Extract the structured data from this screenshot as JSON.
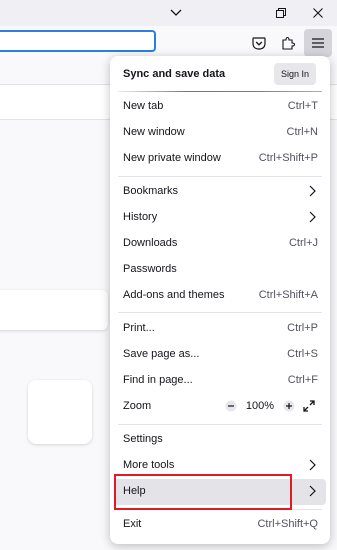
{
  "menu": {
    "sync_title": "Sync and save data",
    "sign_in_label": "Sign In",
    "items": [
      {
        "label": "New tab",
        "shortcut": "Ctrl+T"
      },
      {
        "label": "New window",
        "shortcut": "Ctrl+N"
      },
      {
        "label": "New private window",
        "shortcut": "Ctrl+Shift+P"
      },
      {
        "label": "Bookmarks",
        "shortcut": ""
      },
      {
        "label": "History",
        "shortcut": ""
      },
      {
        "label": "Downloads",
        "shortcut": "Ctrl+J"
      },
      {
        "label": "Passwords",
        "shortcut": ""
      },
      {
        "label": "Add-ons and themes",
        "shortcut": "Ctrl+Shift+A"
      },
      {
        "label": "Print...",
        "shortcut": "Ctrl+P"
      },
      {
        "label": "Save page as...",
        "shortcut": "Ctrl+S"
      },
      {
        "label": "Find in page...",
        "shortcut": "Ctrl+F"
      },
      {
        "label": "Zoom",
        "shortcut": ""
      },
      {
        "label": "Settings",
        "shortcut": ""
      },
      {
        "label": "More tools",
        "shortcut": ""
      },
      {
        "label": "Help",
        "shortcut": ""
      },
      {
        "label": "Exit",
        "shortcut": "Ctrl+Shift+Q"
      }
    ],
    "zoom": {
      "minus": "−",
      "value": "100%",
      "plus": "+"
    }
  },
  "icons": {
    "minimize_tab_list": "chevron-down-icon",
    "restore": "restore-icon",
    "close": "close-icon",
    "pocket": "pocket-icon",
    "extensions": "puzzle-piece-icon",
    "app_menu": "hamburger-menu-icon",
    "fullscreen": "fullscreen-icon"
  },
  "colors": {
    "highlight_outline": "#e01b24",
    "urlbar_focus": "#2c7fe0",
    "hovered_item": "#e4e3e8"
  }
}
